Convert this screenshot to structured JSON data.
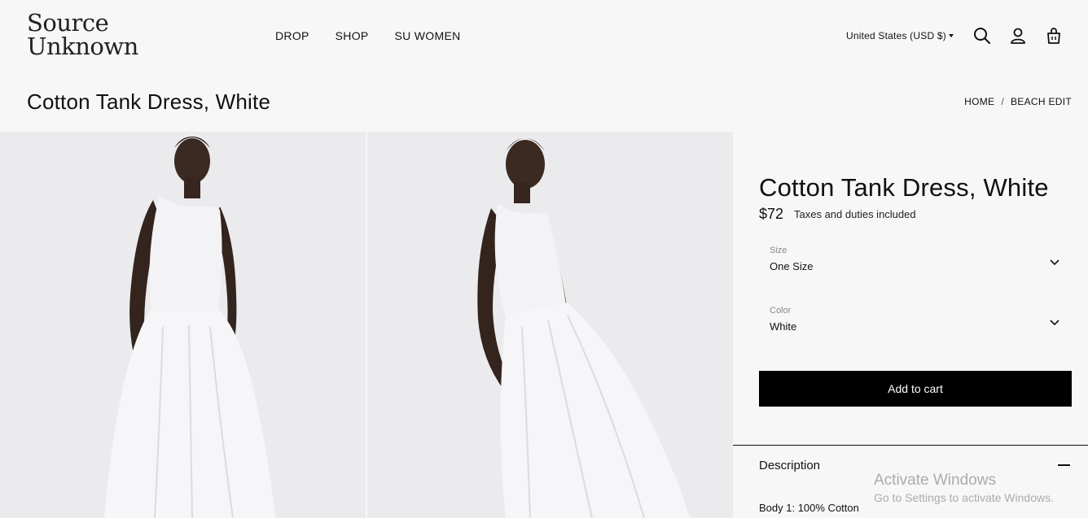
{
  "brand": {
    "line1": "Source",
    "line2": "Unknown"
  },
  "nav": {
    "items": [
      "DROP",
      "SHOP",
      "SU WOMEN"
    ]
  },
  "header": {
    "locale": "United States (USD $)",
    "icons": [
      "search-icon",
      "account-icon",
      "cart-icon"
    ]
  },
  "page": {
    "title": "Cotton Tank Dress, White"
  },
  "breadcrumb": {
    "home": "HOME",
    "separator": "/",
    "current": "BEACH EDIT"
  },
  "product": {
    "title": "Cotton Tank Dress, White",
    "price": "$72",
    "tax_note": "Taxes and duties included",
    "size": {
      "label": "Size",
      "value": "One Size"
    },
    "color": {
      "label": "Color",
      "value": "White"
    },
    "add_to_cart": "Add to cart",
    "description": {
      "heading": "Description",
      "body": "Body 1: 100% Cotton"
    }
  },
  "watermark": {
    "line1": "Activate Windows",
    "line2": "Go to Settings to activate Windows."
  },
  "colors": {
    "background": "#f7f7f8",
    "button": "#000000",
    "text": "#111111"
  }
}
